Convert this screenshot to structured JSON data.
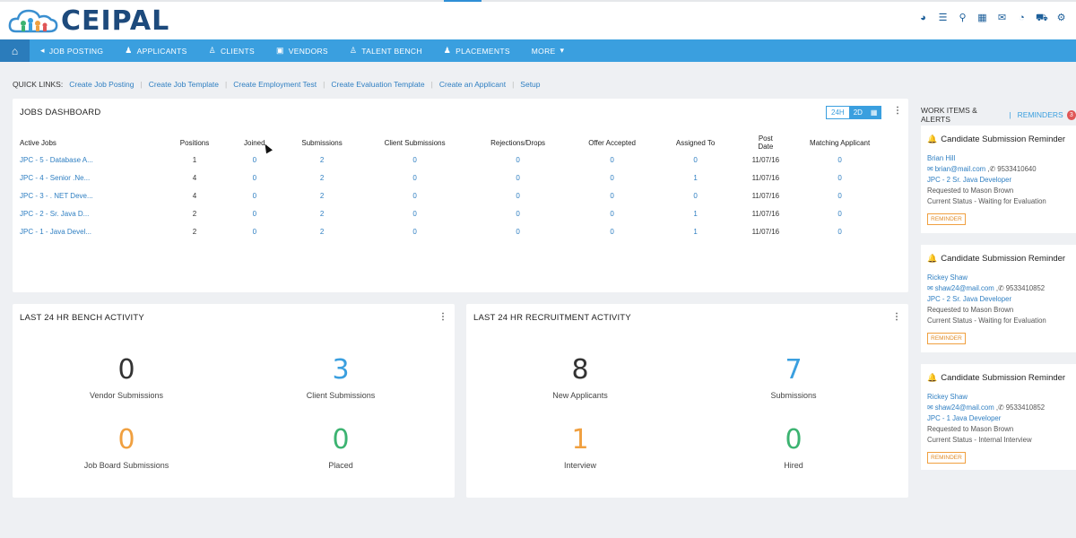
{
  "logo": {
    "text": "CEIPAL"
  },
  "top_icons": [
    "pie-chart-icon",
    "list-icon",
    "search-icon",
    "calendar-icon",
    "mail-icon",
    "clock-icon",
    "cart-icon",
    "settings-icon"
  ],
  "nav": {
    "items": [
      {
        "label": "JOB POSTING",
        "icon": "megaphone-icon"
      },
      {
        "label": "APPLICANTS",
        "icon": "users-icon"
      },
      {
        "label": "CLIENTS",
        "icon": "user-icon"
      },
      {
        "label": "VENDORS",
        "icon": "briefcase-icon"
      },
      {
        "label": "TALENT BENCH",
        "icon": "person-icon"
      },
      {
        "label": "PLACEMENTS",
        "icon": "user-plus-icon"
      },
      {
        "label": "MORE",
        "icon": "caret-down-icon"
      }
    ]
  },
  "quick_links": {
    "label": "QUICK LINKS:",
    "links": [
      "Create Job Posting",
      "Create Job Template",
      "Create Employment Test",
      "Create Evaluation Template",
      "Create an Applicant",
      "Setup"
    ]
  },
  "jobs_dashboard": {
    "title": "JOBS DASHBOARD",
    "toggle": {
      "a": "24H",
      "b": "2D"
    },
    "columns": [
      "Active Jobs",
      "Positions",
      "Joined",
      "Submissions",
      "Client Submissions",
      "Rejections/Drops",
      "Offer Accepted",
      "Assigned To",
      "Post Date",
      "Matching Applicant"
    ],
    "rows": [
      {
        "job": "JPC - 5 - Database A...",
        "positions": "1",
        "joined": "0",
        "submissions": "2",
        "client": "0",
        "rejections": "0",
        "offer": "0",
        "assigned": "0",
        "date": "11/07/16",
        "matching": "0"
      },
      {
        "job": "JPC - 4 - Senior .Ne...",
        "positions": "4",
        "joined": "0",
        "submissions": "2",
        "client": "0",
        "rejections": "0",
        "offer": "0",
        "assigned": "1",
        "date": "11/07/16",
        "matching": "0"
      },
      {
        "job": "JPC - 3 - . NET Deve...",
        "positions": "4",
        "joined": "0",
        "submissions": "2",
        "client": "0",
        "rejections": "0",
        "offer": "0",
        "assigned": "0",
        "date": "11/07/16",
        "matching": "0"
      },
      {
        "job": "JPC - 2 - Sr. Java D...",
        "positions": "2",
        "joined": "0",
        "submissions": "2",
        "client": "0",
        "rejections": "0",
        "offer": "0",
        "assigned": "1",
        "date": "11/07/16",
        "matching": "0"
      },
      {
        "job": "JPC - 1 - Java Devel...",
        "positions": "2",
        "joined": "0",
        "submissions": "2",
        "client": "0",
        "rejections": "0",
        "offer": "0",
        "assigned": "1",
        "date": "11/07/16",
        "matching": "0"
      }
    ]
  },
  "bench": {
    "title": "LAST 24 HR BENCH ACTIVITY",
    "stats": [
      {
        "value": "0",
        "label": "Vendor Submissions",
        "color": "#333333"
      },
      {
        "value": "3",
        "label": "Client Submissions",
        "color": "#3a9fdf"
      },
      {
        "value": "0",
        "label": "Job Board Submissions",
        "color": "#f0a040"
      },
      {
        "value": "0",
        "label": "Placed",
        "color": "#3cb371"
      }
    ]
  },
  "recruitment": {
    "title": "LAST 24 HR RECRUITMENT ACTIVITY",
    "stats": [
      {
        "value": "8",
        "label": "New Applicants",
        "color": "#333333"
      },
      {
        "value": "7",
        "label": "Submissions",
        "color": "#3a9fdf"
      },
      {
        "value": "1",
        "label": "Interview",
        "color": "#f0a040"
      },
      {
        "value": "0",
        "label": "Hired",
        "color": "#3cb371"
      }
    ]
  },
  "work_items": {
    "title": "WORK ITEMS & ALERTS",
    "reminders_label": "REMINDERS",
    "reminders_count": "3",
    "cards": [
      {
        "title": "Candidate Submission Reminder",
        "name": "Brian Hill",
        "email": "brian@mail.com",
        "phone": "9533410640",
        "job": "JPC - 2 Sr. Java Developer",
        "requested": "Requested to Mason Brown",
        "status": "Current Status - Waiting for Evaluation",
        "badge": "REMINDER"
      },
      {
        "title": "Candidate Submission Reminder",
        "name": "Rickey Shaw",
        "email": "shaw24@mail.com",
        "phone": "9533410852",
        "job": "JPC - 2 Sr. Java Developer",
        "requested": "Requested to Mason Brown",
        "status": "Current Status - Waiting for Evaluation",
        "badge": "REMINDER"
      },
      {
        "title": "Candidate Submission Reminder",
        "name": "Rickey Shaw",
        "email": "shaw24@mail.com",
        "phone": "9533410852",
        "job": "JPC - 1 Java Developer",
        "requested": "Requested to Mason Brown",
        "status": "Current Status - Internal Interview",
        "badge": "REMINDER"
      }
    ]
  }
}
